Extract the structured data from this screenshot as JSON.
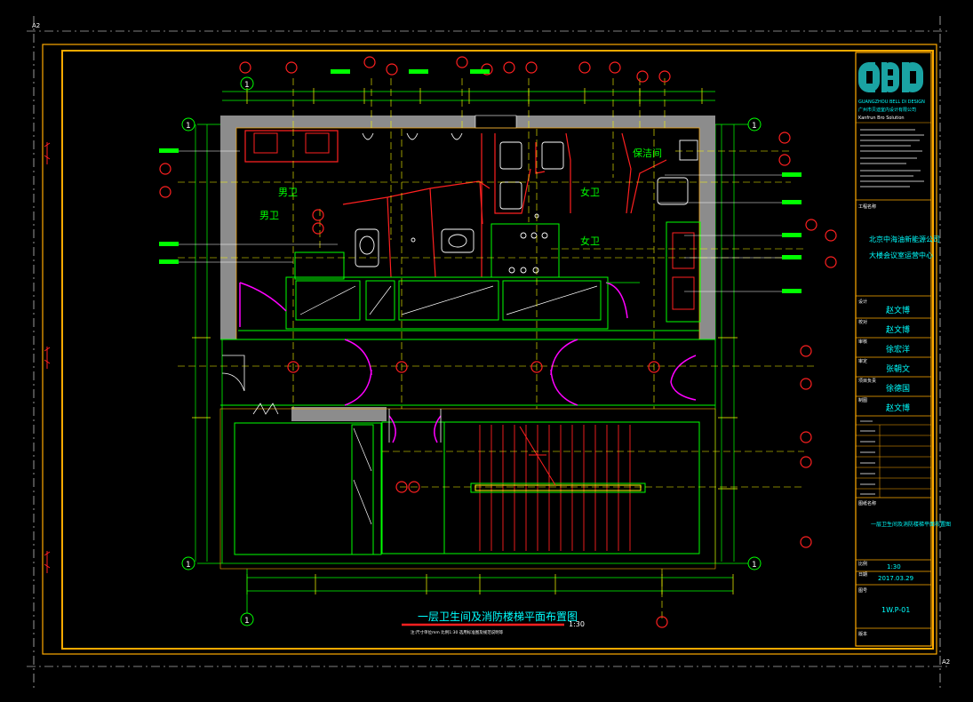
{
  "sheet": {
    "size_tag_top": "A2",
    "size_tag_bottom": "A2",
    "colors": {
      "frame": "#ffaa00",
      "wall": "#8c8c8c",
      "line": "#00ff00",
      "partition": "#ff2020",
      "door": "#ff00ff",
      "dim": "#ffff00",
      "grid": "#00ff00",
      "text": "#00ffff"
    }
  },
  "drawing": {
    "title": "一层卫生间及消防楼梯平面布置图",
    "scale": "1:30",
    "note": "注:尺寸单位mm 比例1:30 选用标准图及规范说明等"
  },
  "rooms": {
    "male": "男卫",
    "male_b": "男卫",
    "female": "女卫",
    "female_b": "女卫",
    "cleaning": "保洁间"
  },
  "grid": {
    "axis_1_label": "1"
  },
  "title_block": {
    "company_en": "GUANGZHOU BELL DI DESIGN",
    "company_cn": "广州市贝迪室内设计有限公司",
    "company_sub": "Kanfrun Bro Solution",
    "project_label": "工程名称",
    "project_line1": "北京中海油新能源公司",
    "project_line2": "大楼会议室运营中心",
    "roles": [
      {
        "label": "设计",
        "name": "赵文博"
      },
      {
        "label": "校对",
        "name": "赵文博"
      },
      {
        "label": "审核",
        "name": "徐宏洋"
      },
      {
        "label": "审定",
        "name": "张朝文"
      },
      {
        "label": "项目负责",
        "name": "徐德国"
      },
      {
        "label": "制图",
        "name": "赵文博"
      }
    ],
    "drawing_name_label": "图纸名称",
    "drawing_name": "一层卫生间及消防楼梯平面布置图",
    "scale_label": "比例",
    "scale": "1:30",
    "date_label": "日期",
    "date": "2017.03.29",
    "sheet_no_label": "图号",
    "sheet_no": "1W.P-01",
    "version_label": "版本"
  }
}
